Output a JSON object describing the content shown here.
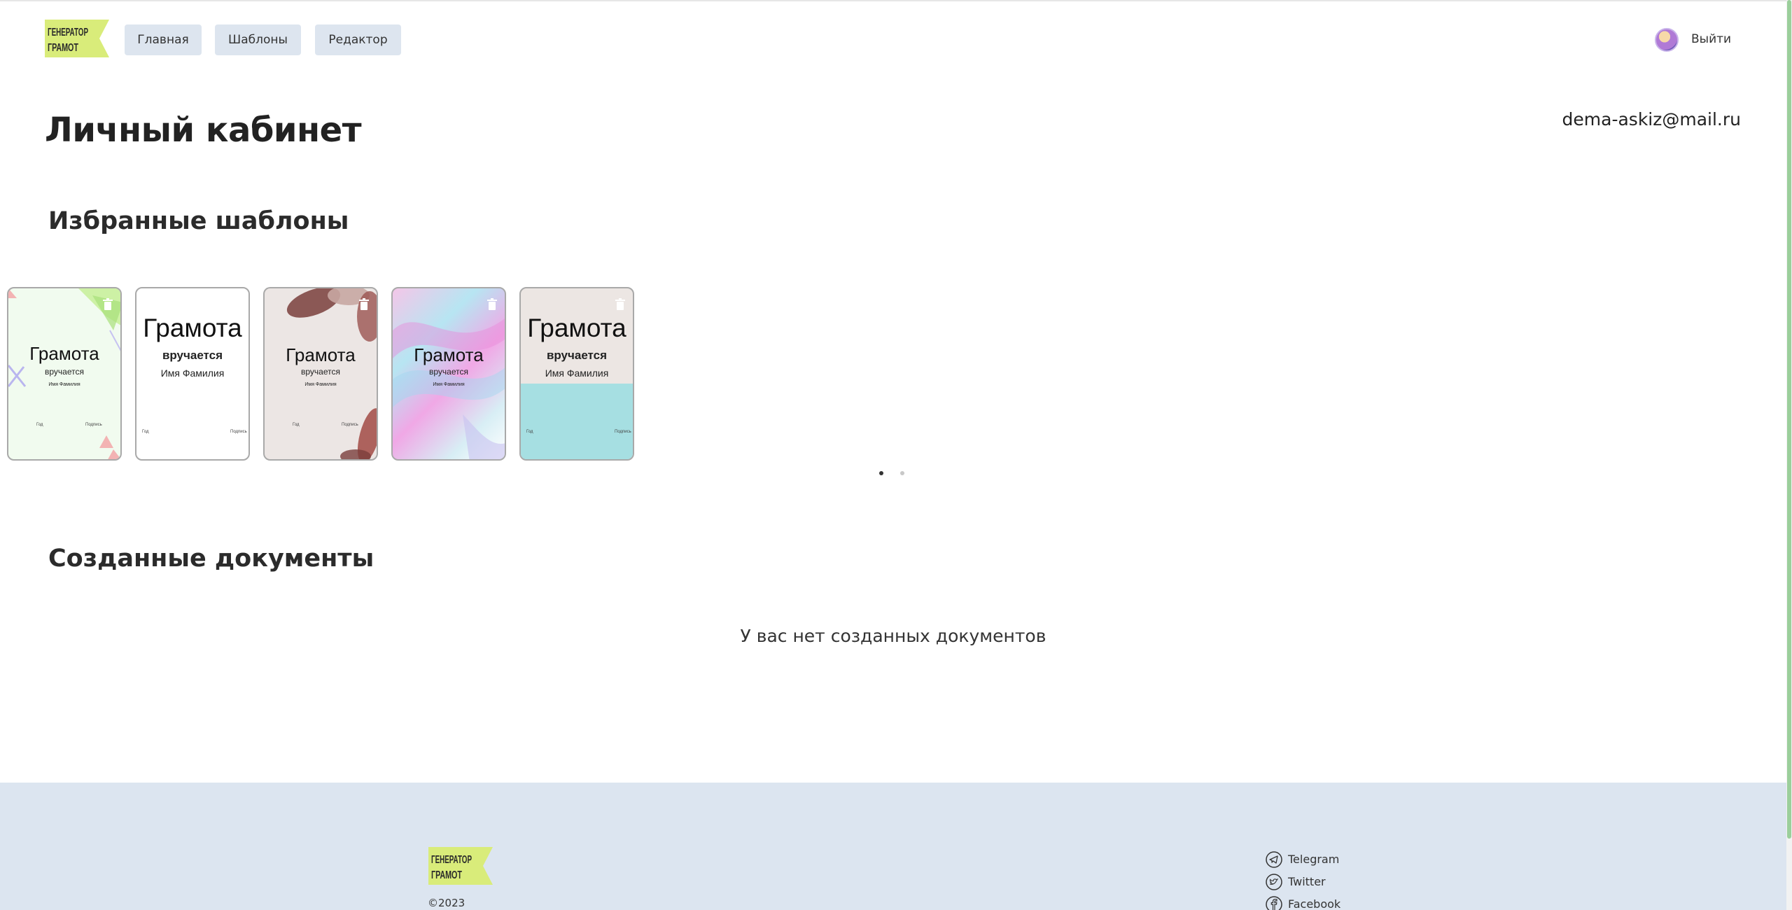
{
  "header": {
    "logo_line1": "ГЕНЕРАТОР",
    "logo_line2": "ГРАМОТ",
    "nav": [
      "Главная",
      "Шаблоны",
      "Редактор"
    ],
    "logout_label": "Выйти"
  },
  "page": {
    "title": "Личный кабинет",
    "email": "dema-askiz@mail.ru"
  },
  "favorites": {
    "title": "Избранные шаблоны",
    "cards": [
      {
        "title": "Грамота",
        "subtitle": "вручается",
        "name": "Имя Фамилия",
        "left_caption": "Год",
        "right_caption": "Подпись"
      },
      {
        "title": "Грамота",
        "subtitle": "вручается",
        "name": "Имя Фамилия",
        "left_caption": "Год",
        "right_caption": "Подпись"
      },
      {
        "title": "Грамота",
        "subtitle": "вручается",
        "name": "Имя Фамилия",
        "left_caption": "Год",
        "right_caption": "Подпись"
      },
      {
        "title": "Грамота",
        "subtitle": "вручается",
        "name": "Имя Фамилия",
        "left_caption": "Год",
        "right_caption": "Подпись"
      },
      {
        "title": "Грамота",
        "subtitle": "вручается",
        "name": "Имя Фамилия",
        "left_caption": "Год",
        "right_caption": "Подпись"
      }
    ],
    "pagination": {
      "pages": 2,
      "current": 1
    }
  },
  "documents": {
    "title": "Созданные документы",
    "empty_message": "У вас нет созданных документов"
  },
  "footer": {
    "logo_line1": "ГЕНЕРАТОР",
    "logo_line2": "ГРАМОТ",
    "copyright": "©2023",
    "social": [
      {
        "label": "Telegram",
        "icon": "telegram-icon"
      },
      {
        "label": "Twitter",
        "icon": "twitter-icon"
      },
      {
        "label": "Facebook",
        "icon": "facebook-icon"
      }
    ]
  },
  "colors": {
    "nav_button_bg": "#dde5ef",
    "footer_bg": "#dce5f0",
    "logo_bg": "#d9ec7a",
    "card_5_bottom": "#a6dfe2"
  }
}
